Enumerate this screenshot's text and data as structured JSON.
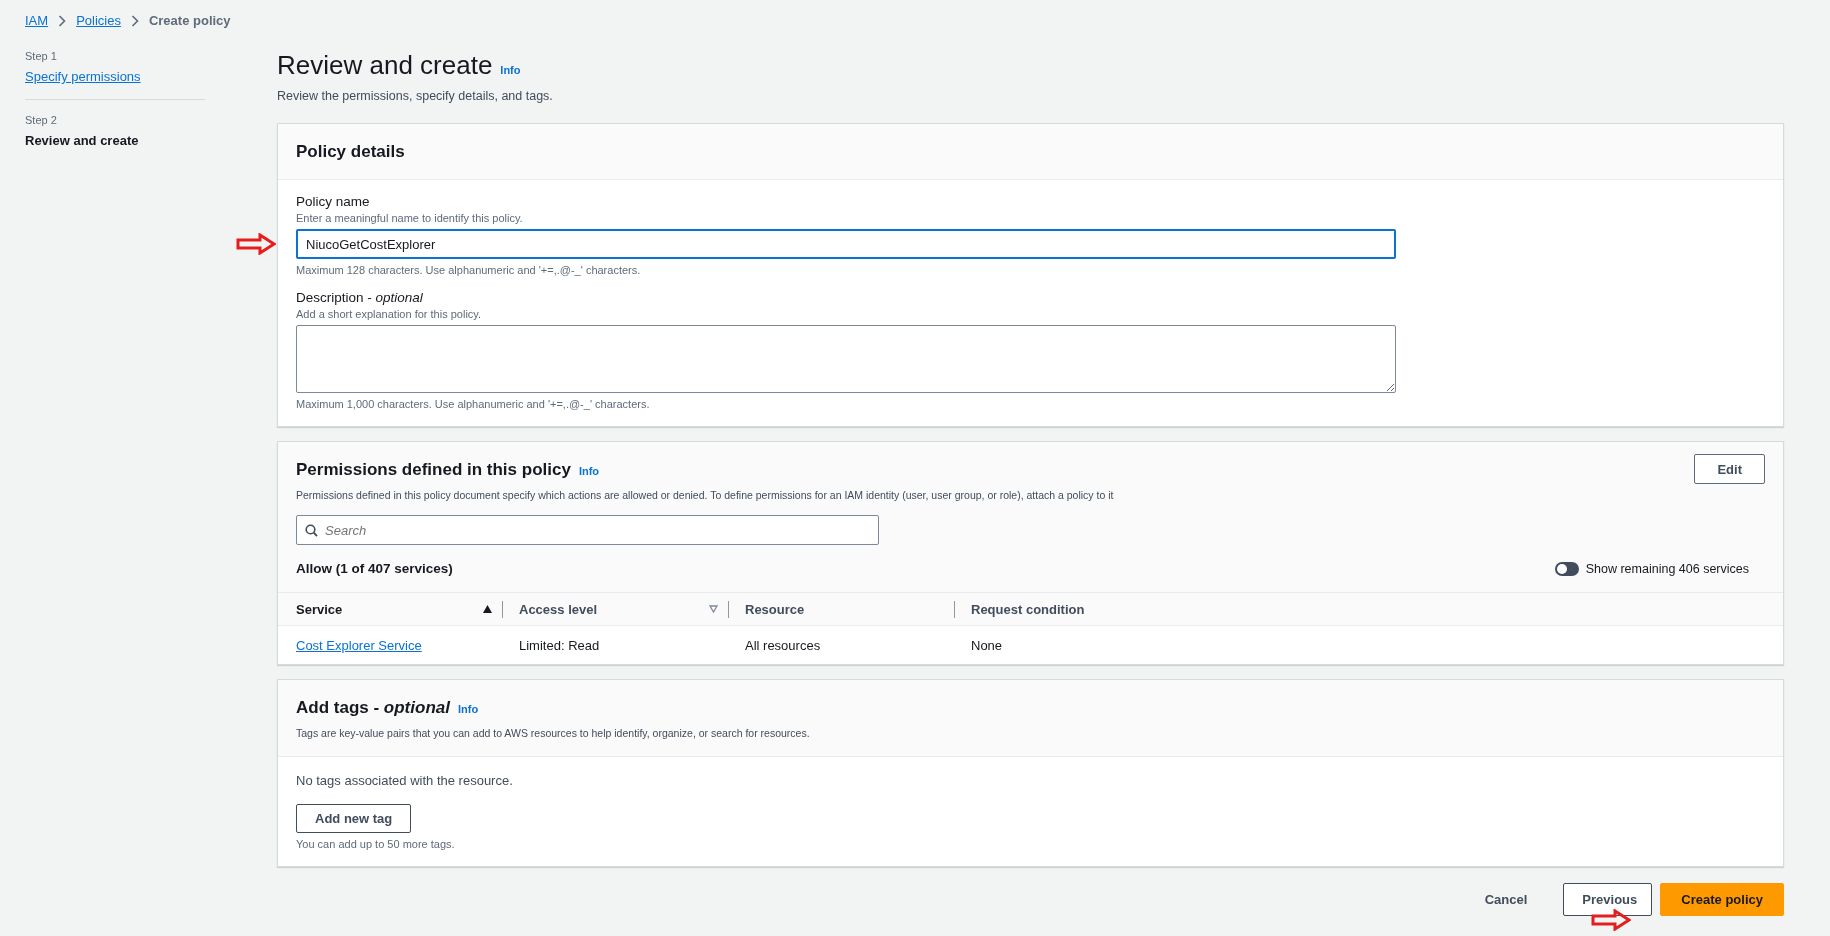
{
  "breadcrumbs": [
    {
      "label": "IAM",
      "kind": "link"
    },
    {
      "label": "Policies",
      "kind": "link"
    },
    {
      "label": "Create policy",
      "kind": "current"
    }
  ],
  "steps": [
    {
      "step": "Step 1",
      "label": "Specify permissions",
      "selected": false
    },
    {
      "step": "Step 2",
      "label": "Review and create",
      "selected": true
    }
  ],
  "page": {
    "title": "Review and create",
    "info": "Info",
    "subtitle": "Review the permissions, specify details, and tags."
  },
  "policy_details": {
    "heading": "Policy details",
    "name_field": {
      "label": "Policy name",
      "hint": "Enter a meaningful name to identify this policy.",
      "value": "NiucoGetCostExplorer",
      "constraint": "Maximum 128 characters. Use alphanumeric and '+=,.@-_' characters."
    },
    "description_field": {
      "label": "Description - *optional*",
      "hint": "Add a short explanation for this policy.",
      "constraint": "Maximum 1,000 characters. Use alphanumeric and '+=,.@-_' characters."
    }
  },
  "permissions": {
    "heading": "Permissions defined in this policy",
    "info": "Info",
    "description": "Permissions defined in this policy document specify which actions are allowed or denied. To define permissions for an IAM identity (user, user group, or role), attach a policy to it",
    "edit_button": "Edit",
    "search": {
      "placeholder": "Search"
    },
    "allow_heading": "Allow (1 of 407 services)",
    "toggle": {
      "label": "Show remaining 406 services",
      "on": false
    },
    "columns": [
      {
        "label": "Service",
        "sortable": true,
        "sorted": true
      },
      {
        "label": "Access level",
        "sortable": true,
        "sorted": false
      },
      {
        "label": "Resource",
        "sortable": false,
        "sorted": false
      },
      {
        "label": "Request condition",
        "sortable": false,
        "sorted": false
      }
    ],
    "rows": [
      {
        "cells": [
          "Cost Explorer Service",
          "Limited: Read",
          "All resources",
          "None"
        ]
      }
    ]
  },
  "tags": {
    "heading": "Add tags - *optional*",
    "info": "Info",
    "description": "Tags are key-value pairs that you can add to AWS resources to help identify, organize, or search for resources.",
    "empty_text": "No tags associated with the resource.",
    "add_button": "Add new tag",
    "limit_text": "You can add up to 50 more tags."
  },
  "footer": {
    "buttons": [
      {
        "label": "Cancel",
        "kind": "link"
      },
      {
        "label": "Previous",
        "kind": "normal"
      },
      {
        "label": "Create policy",
        "kind": "primary"
      }
    ]
  }
}
